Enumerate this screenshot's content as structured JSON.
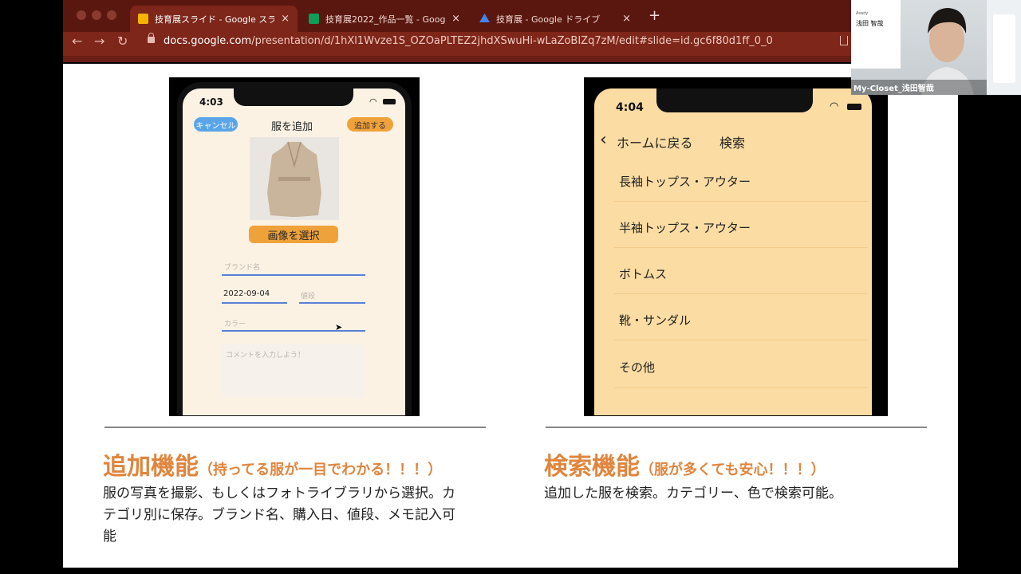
{
  "browser": {
    "tabs": [
      {
        "title": "技育展スライド - Google スライド",
        "active": true,
        "favicon_color": "#f4b400"
      },
      {
        "title": "技育展2022_作品一覧 - Google",
        "active": false,
        "favicon_color": "#0f9d58"
      },
      {
        "title": "技育展 - Google ドライブ",
        "active": false,
        "favicon_color": "#4285f4"
      }
    ],
    "new_tab": "+",
    "close": "×",
    "url_host": "docs.google.com",
    "url_path": "/presentation/d/1hXl1Wvze1S_OZOaPLTEZ2jhdXSwuHi-wLaZoBIZq7zM/edit#slide=id.gc6f80d1ff_0_0"
  },
  "phone_add": {
    "time": "4:03",
    "cancel": "キャンセル",
    "title": "服を追加",
    "add": "追加する",
    "select_image": "画像を選択",
    "brand_placeholder": "ブランド名",
    "date_value": "2022-09-04",
    "price_placeholder": "値段",
    "color_placeholder": "カラー",
    "comment_placeholder": "コメントを入力しよう！"
  },
  "phone_search": {
    "time": "4:04",
    "back": "ホームに戻る",
    "title": "検索",
    "categories": [
      "長袖トップス・アウター",
      "半袖トップス・アウター",
      "ボトムス",
      "靴・サンダル",
      "その他"
    ]
  },
  "section_add": {
    "heading": "追加機能",
    "sub": "（持ってる服が一目でわかる！！！）",
    "body": "服の写真を撮影、もしくはフォトライブラリから選択。カテゴリ別に保存。ブランド名、購入日、値段、メモ記入可能"
  },
  "section_search": {
    "heading": "検索機能",
    "sub": "（服が多くても安心！！！）",
    "body": "追加した服を検索。カテゴリー、色で検索可能。"
  },
  "webcam": {
    "name_label": "My-Closet_浅田智哉",
    "slide_name": "浅田 智哉",
    "slide_small": "Asady"
  }
}
